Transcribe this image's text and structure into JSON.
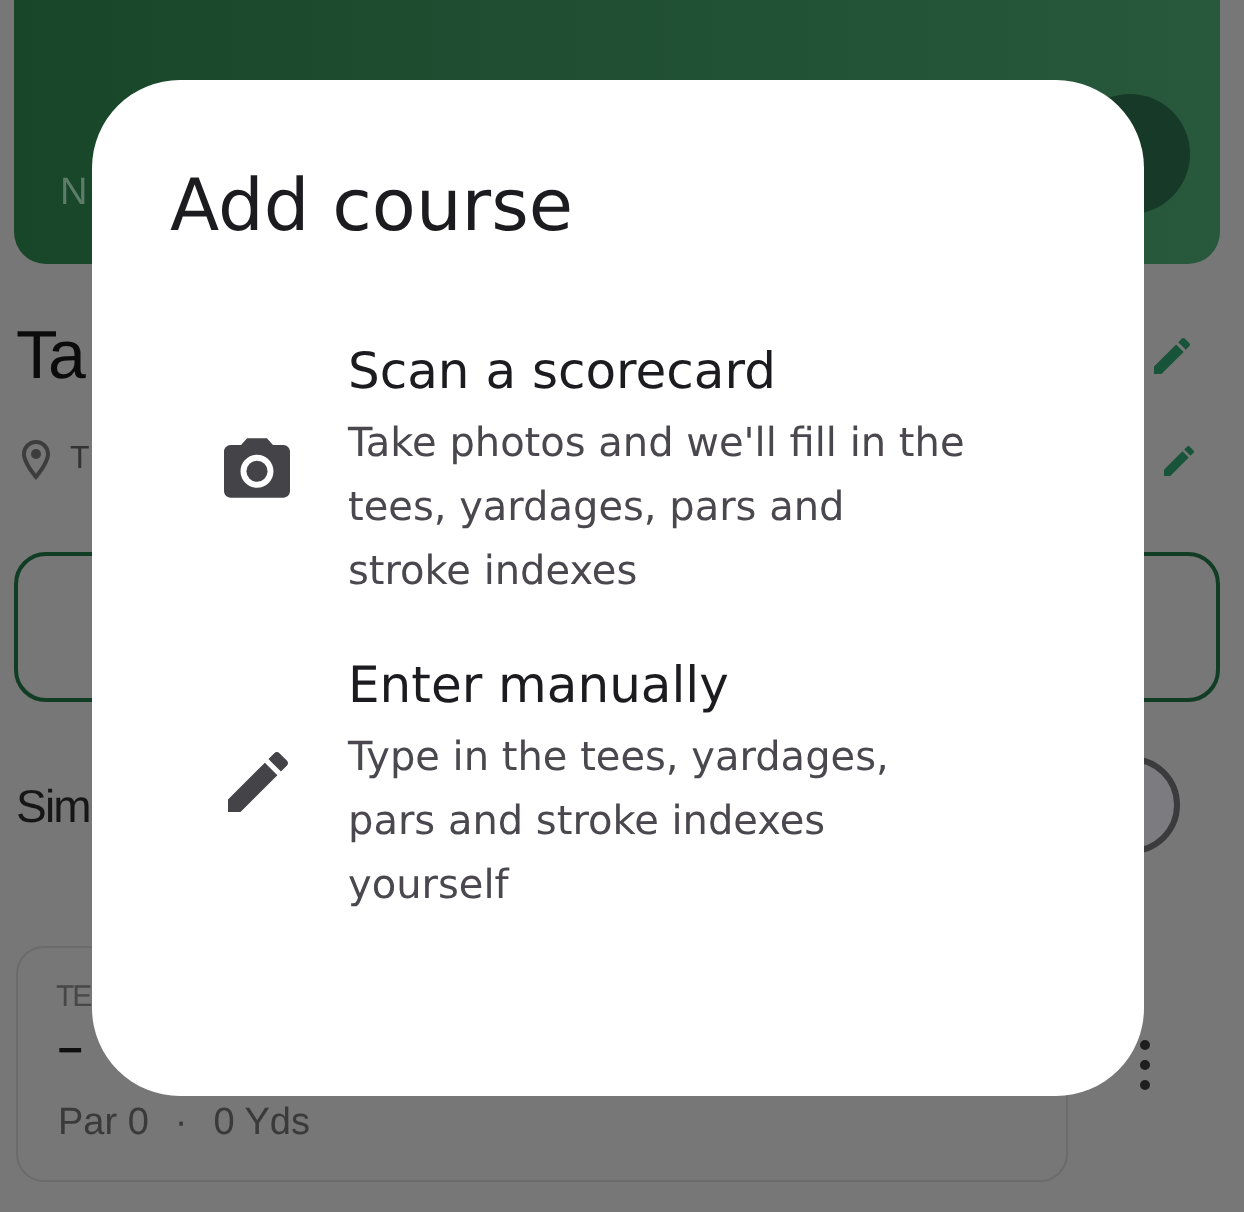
{
  "background": {
    "header": {
      "label": "N"
    },
    "course": {
      "title": "Ta",
      "location": "T"
    },
    "setting": {
      "label": "Sim"
    },
    "tee_card": {
      "label": "TE",
      "name": "–",
      "par": "Par 0",
      "separator": "·",
      "yards": "0 Yds"
    }
  },
  "dialog": {
    "title": "Add course",
    "options": [
      {
        "kind": "scan",
        "title": "Scan a scorecard",
        "description": "Take photos and we'll fill in the tees, yardages, pars and stroke indexes"
      },
      {
        "kind": "manual",
        "title": "Enter manually",
        "description": "Type in the tees, yardages, pars and stroke indexes yourself"
      }
    ]
  }
}
